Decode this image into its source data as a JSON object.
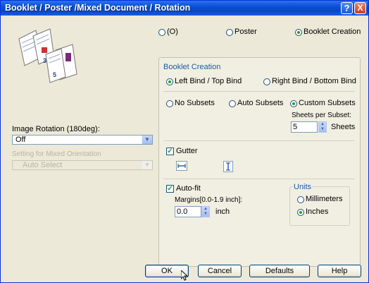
{
  "window": {
    "title": "Booklet / Poster /Mixed Document / Rotation",
    "help_glyph": "?",
    "close_glyph": "X"
  },
  "layout_mode": {
    "options": [
      {
        "label": "(O)",
        "selected": false
      },
      {
        "label": "Poster",
        "selected": false
      },
      {
        "label": "Booklet Creation",
        "selected": true
      }
    ]
  },
  "preview": {
    "page_numbers": [
      "3",
      "5"
    ]
  },
  "left": {
    "rotation_label": "Image Rotation (180deg):",
    "rotation_value": "Off",
    "mixed_label": "Setting for Mixed Orientation",
    "mixed_value": "Auto Select"
  },
  "booklet": {
    "group_label": "Booklet Creation",
    "bind_options": [
      {
        "label": "Left Bind / Top Bind",
        "selected": true
      },
      {
        "label": "Right Bind / Bottom Bind",
        "selected": false
      }
    ],
    "subset_options": [
      {
        "label": "No Subsets",
        "selected": false
      },
      {
        "label": "Auto Subsets",
        "selected": false
      },
      {
        "label": "Custom Subsets",
        "selected": true
      }
    ],
    "sheets_label": "Sheets per Subset:",
    "sheets_value": "5",
    "sheets_unit": "Sheets",
    "gutter_label": "Gutter",
    "gutter_checked": true,
    "autofit_label": "Auto-fit",
    "autofit_checked": true,
    "margins_label": "Margins[0.0-1.9 inch]:",
    "margins_value": "0.0",
    "margins_unit": "inch",
    "units_label": "Units",
    "unit_options": [
      {
        "label": "Millimeters",
        "selected": false
      },
      {
        "label": "Inches",
        "selected": true
      }
    ]
  },
  "buttons": {
    "ok": "OK",
    "cancel": "Cancel",
    "defaults": "Defaults",
    "help": "Help"
  },
  "colors": {
    "titlebar": "#0a4fd4",
    "radio_selected": "#21a121",
    "group_label": "#1a5aaa"
  }
}
